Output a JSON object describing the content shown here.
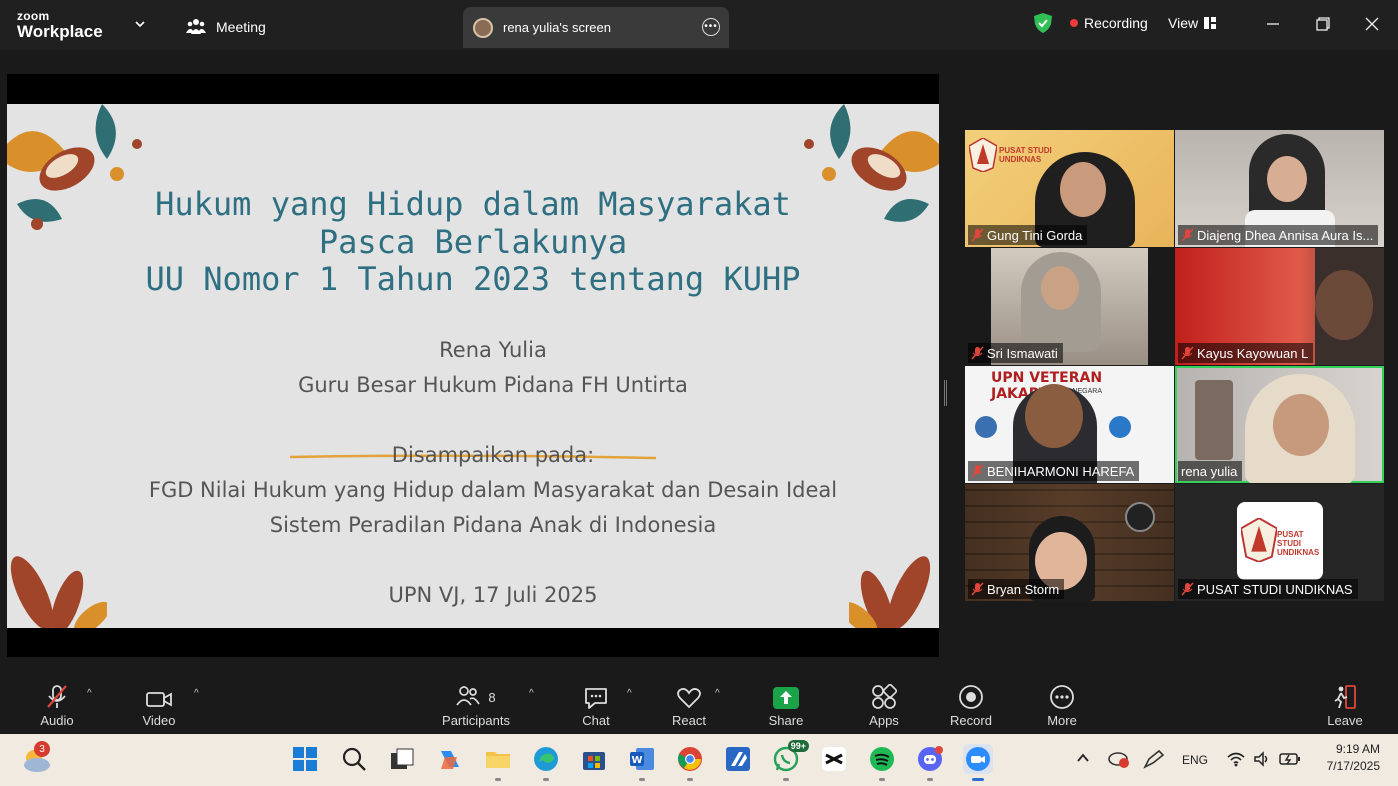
{
  "titlebar": {
    "logo_top": "zoom",
    "logo_bottom": "Workplace",
    "meeting_tab": "Meeting",
    "screen_tab": "rena yulia's screen",
    "recording": "Recording",
    "view": "View"
  },
  "slide": {
    "title_lines": [
      "Hukum yang Hidup dalam Masyarakat",
      "Pasca Berlakunya",
      "UU Nomor 1 Tahun 2023 tentang KUHP"
    ],
    "presenter": "Rena Yulia",
    "position": "Guru Besar Hukum Pidana FH Untirta",
    "delivered_at": "Disampaikan pada:",
    "event_line1": "FGD Nilai Hukum yang Hidup dalam Masyarakat dan Desain Ideal",
    "event_line2": "Sistem Peradilan Pidana Anak di Indonesia",
    "place_date": "UPN VJ, 17 Juli 2025"
  },
  "participants": [
    {
      "name": "Gung Tini Gorda",
      "muted": true
    },
    {
      "name": "Diajeng Dhea Annisa Aura Is...",
      "muted": true
    },
    {
      "name": "Sri Ismawati",
      "muted": true
    },
    {
      "name": "Kayus Kayowuan L",
      "muted": true
    },
    {
      "name": "BENIHARMONI HAREFA",
      "muted": true
    },
    {
      "name": "rena yulia",
      "muted": false
    },
    {
      "name": "Bryan Storm",
      "muted": true
    },
    {
      "name": "PUSAT STUDI UNDIKNAS",
      "muted": true
    }
  ],
  "tile_text": {
    "pusat_studi": "PUSAT STUDI",
    "undiknas": "UNDIKNAS",
    "upn_banner": "UPN VETERAN JAKARTA",
    "bela_negara": "BELA NEGARA"
  },
  "toolbar": {
    "audio": "Audio",
    "video": "Video",
    "participants": "Participants",
    "participants_count": "8",
    "chat": "Chat",
    "react": "React",
    "share": "Share",
    "apps": "Apps",
    "record": "Record",
    "more": "More",
    "leave": "Leave"
  },
  "taskbar": {
    "weather_badge": "3",
    "whatsapp_badge": "99+",
    "language": "ENG",
    "time": "9:19 AM",
    "date": "7/17/2025"
  },
  "colors": {
    "accent_green": "#34d25a",
    "recording_red": "#ef3b3b",
    "slide_title": "#2e6f82",
    "share_green": "#1ba34a"
  }
}
